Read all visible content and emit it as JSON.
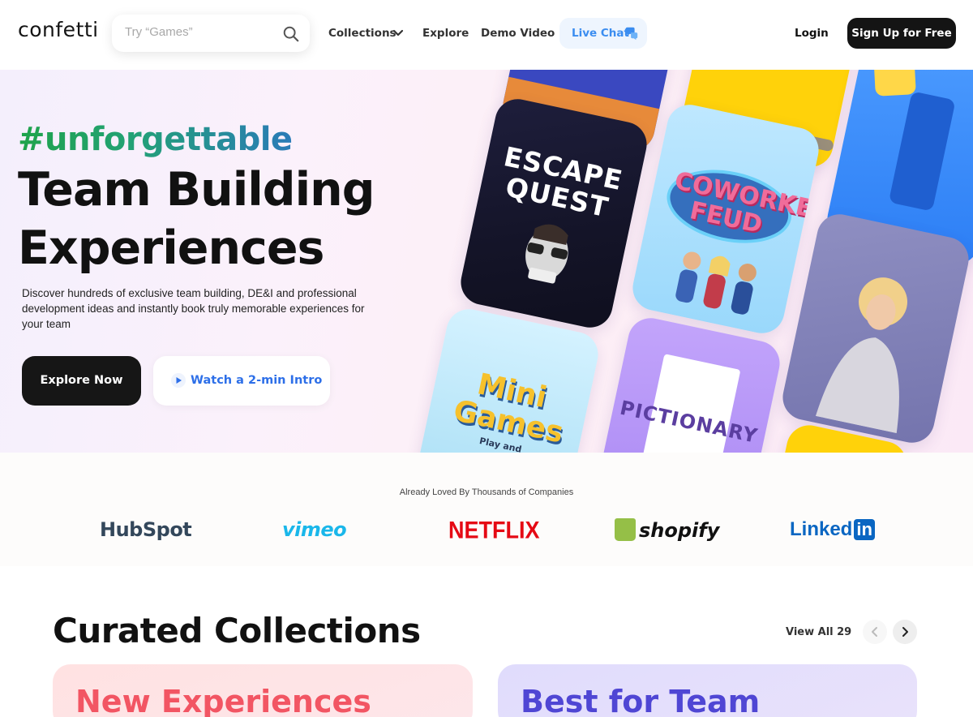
{
  "header": {
    "logo": "confetti",
    "search_placeholder": "Try “Games”",
    "nav": {
      "collections": "Collections",
      "explore": "Explore",
      "demo_video": "Demo Video",
      "live_chat": "Live Chat"
    },
    "login": "Login",
    "signup": "Sign Up for Free"
  },
  "hero": {
    "hashtag": "#unforgettable",
    "headline_line1": "Team Building",
    "headline_line2": "Experiences",
    "description": "Discover hundreds of exclusive team building, DE&I and professional development ideas and instantly book truly memorable experiences for your team",
    "explore_button": "Explore Now",
    "watch_button": "Watch a 2-min Intro",
    "tiles": {
      "escape_quest": "ESCAPE QUEST",
      "coworker_feud": "COWORKER FEUD",
      "mini_games": "Mini Games",
      "mini_games_sub": "Play and",
      "pictionary": "PICTIONARY"
    }
  },
  "logos": {
    "caption": "Already Loved By Thousands of Companies",
    "hubspot": "HubSpot",
    "vimeo": "vimeo",
    "netflix": "NETFLIX",
    "shopify": "shopify",
    "linkedin_text": "Linked",
    "linkedin_box": "in"
  },
  "collections": {
    "title": "Curated Collections",
    "view_all": "View All 29",
    "cards": [
      {
        "title": "New Experiences"
      },
      {
        "title": "Best for Team"
      }
    ]
  },
  "colors": {
    "accent_blue": "#2d6fe8",
    "hashtag_green": "#1fa34a",
    "dark": "#141414",
    "card_new": "#f25563",
    "card_best": "#4f46d4"
  },
  "icons": [
    "search-icon",
    "chevron-down-icon",
    "chat-bubble-icon",
    "play-icon",
    "chevron-left-icon",
    "chevron-right-icon"
  ]
}
